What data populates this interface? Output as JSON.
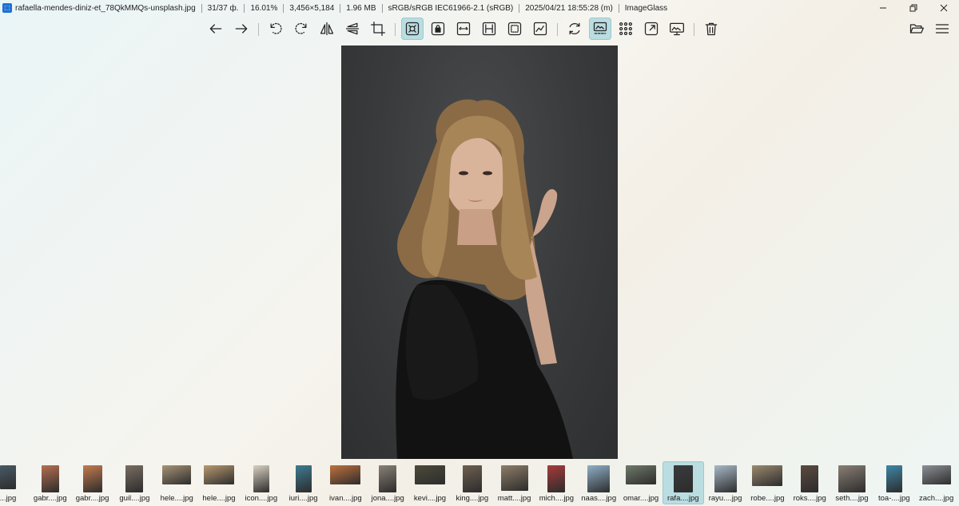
{
  "titlebar": {
    "filename": "rafaella-mendes-diniz-et_78QkMMQs-unsplash.jpg",
    "position": "31/37 ф.",
    "zoom": "16.01%",
    "dimensions": "3,456×5,184",
    "filesize": "1.96 MB",
    "color_profile": "sRGB/sRGB IEC61966-2.1 (sRGB)",
    "modified": "2025/04/21 18:55:28 (m)",
    "app_name": "ImageGlass"
  },
  "toolbar": {
    "buttons": [
      {
        "icon": "arrow-left-icon",
        "label": "Previous image"
      },
      {
        "icon": "arrow-right-icon",
        "label": "Next image"
      },
      {
        "icon": "rotate-left-icon",
        "label": "Rotate left"
      },
      {
        "icon": "rotate-right-icon",
        "label": "Rotate right"
      },
      {
        "icon": "flip-horizontal-icon",
        "label": "Flip horizontal"
      },
      {
        "icon": "flip-vertical-icon",
        "label": "Flip vertical"
      },
      {
        "icon": "crop-icon",
        "label": "Crop"
      },
      {
        "icon": "auto-zoom-icon",
        "label": "Auto zoom",
        "active": true
      },
      {
        "icon": "lock-zoom-icon",
        "label": "Lock zoom"
      },
      {
        "icon": "scale-to-width-icon",
        "label": "Scale to width"
      },
      {
        "icon": "scale-to-height-icon",
        "label": "Scale to height"
      },
      {
        "icon": "scale-to-fit-icon",
        "label": "Scale to fit"
      },
      {
        "icon": "scale-to-fill-icon",
        "label": "Scale to fill"
      },
      {
        "icon": "refresh-icon",
        "label": "Refresh"
      },
      {
        "icon": "gallery-icon",
        "label": "Gallery",
        "active": true
      },
      {
        "icon": "checkerboard-icon",
        "label": "Checkerboard"
      },
      {
        "icon": "fullscreen-icon",
        "label": "Full screen"
      },
      {
        "icon": "slideshow-icon",
        "label": "Slideshow"
      },
      {
        "icon": "delete-icon",
        "label": "Delete"
      },
      {
        "icon": "open-folder-icon",
        "label": "Open file"
      },
      {
        "icon": "menu-icon",
        "label": "Main menu"
      }
    ]
  },
  "thumbnails": [
    {
      "label": "...jpg",
      "color": "#4a5a66"
    },
    {
      "label": "gabr....jpg",
      "color": "#b5704f"
    },
    {
      "label": "gabr....jpg",
      "color": "#c47b4e"
    },
    {
      "label": "guil....jpg",
      "color": "#7a6e63"
    },
    {
      "label": "hele....jpg",
      "color": "#a89478"
    },
    {
      "label": "hele....jpg",
      "color": "#b99a70"
    },
    {
      "label": "icon....jpg",
      "color": "#d8d0c2"
    },
    {
      "label": "iuri....jpg",
      "color": "#3e7c93"
    },
    {
      "label": "ivan....jpg",
      "color": "#c0723e"
    },
    {
      "label": "jona....jpg",
      "color": "#8a8077"
    },
    {
      "label": "kevi....jpg",
      "color": "#4d4b3a"
    },
    {
      "label": "king....jpg",
      "color": "#6e6050"
    },
    {
      "label": "matt....jpg",
      "color": "#8e7e68"
    },
    {
      "label": "mich....jpg",
      "color": "#a83a3a"
    },
    {
      "label": "naas....jpg",
      "color": "#8fb0c8"
    },
    {
      "label": "omar....jpg",
      "color": "#6f7a6a"
    },
    {
      "label": "rafa....jpg",
      "color": "#3a3b3d",
      "active": true
    },
    {
      "label": "rayu....jpg",
      "color": "#a9b9c8"
    },
    {
      "label": "robe....jpg",
      "color": "#9c8a70"
    },
    {
      "label": "roks....jpg",
      "color": "#5c4a40"
    },
    {
      "label": "seth....jpg",
      "color": "#8a7f75"
    },
    {
      "label": "toa-....jpg",
      "color": "#3f87a8"
    },
    {
      "label": "zach....jpg",
      "color": "#8f9098"
    }
  ]
}
